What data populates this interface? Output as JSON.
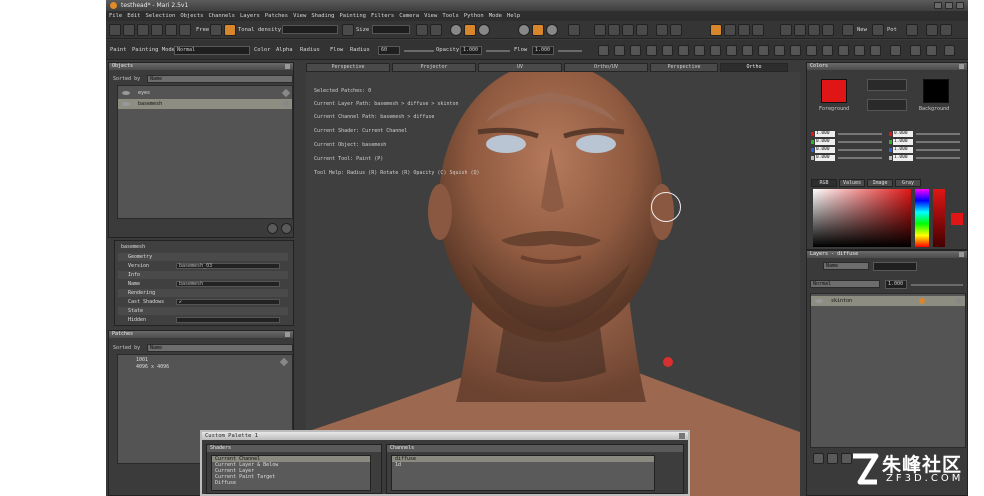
{
  "window": {
    "title": "testhead* - Mari 2.5v1"
  },
  "menu": [
    "File",
    "Edit",
    "Selection",
    "Objects",
    "Channels",
    "Layers",
    "Patches",
    "View",
    "Shading",
    "Painting",
    "Filters",
    "Camera",
    "View",
    "Tools",
    "Python",
    "Mode",
    "Help"
  ],
  "toolbar": {
    "free_label": "Free",
    "tonal_density_label": "Tonal density",
    "size_label": "Size",
    "new_label": "New",
    "pot_label": "Pot"
  },
  "paint_toolbar": {
    "paint_label": "Paint",
    "painting_mode_label": "Painting Mode",
    "painting_mode_value": "Normal",
    "color_label": "Color",
    "alpha_label": "Alpha",
    "radius_label": "Radius",
    "flow_label": "Flow",
    "radius2_label": "Radius",
    "radius_value": "60",
    "opacity_label": "Opacity",
    "opacity_value": "1.000",
    "flow2_label": "Flow",
    "flow_value": "1.000"
  },
  "objects_panel": {
    "title": "Objects",
    "sorted_by_label": "Sorted by",
    "sorted_by_value": "Name",
    "items": [
      "eyes",
      "basemesh"
    ]
  },
  "properties_panel": {
    "object_name": "basemesh",
    "rows": [
      {
        "label": "Geometry",
        "section": true,
        "value": ""
      },
      {
        "label": "Version",
        "section": false,
        "value": "basemesh_03"
      },
      {
        "label": "Info",
        "section": true,
        "value": ""
      },
      {
        "label": "Name",
        "section": false,
        "value": "basemesh"
      },
      {
        "label": "Rendering",
        "section": true,
        "value": ""
      },
      {
        "label": "Cast Shadows",
        "section": false,
        "value": "✔"
      },
      {
        "label": "State",
        "section": true,
        "value": ""
      },
      {
        "label": "Hidden",
        "section": false,
        "value": ""
      }
    ]
  },
  "patches_panel": {
    "title": "Patches",
    "sorted_by_label": "Sorted by",
    "sorted_by_value": "Name",
    "patch_id": "1001",
    "patch_size": "4096 x 4096"
  },
  "view_tabs": [
    "Perspective",
    "Projector",
    "UV",
    "Ortho/UV",
    "Perspective",
    "Ortho"
  ],
  "hud": {
    "selected_patches": "Selected Patches: 0",
    "layer_path": "Current Layer Path: basemesh > diffuse > skinton",
    "channel_path": "Current Channel Path: basemesh > diffuse",
    "shader": "Current Shader: Current Channel",
    "object": "Current Object: basemesh",
    "tool": "Current Tool: Paint (P)",
    "tool_help": "Tool Help:    Radius (R)  Rotate (R)  Opacity (C)  Squish (Q)"
  },
  "colors_panel": {
    "title": "Colors",
    "foreground_label": "Foreground",
    "background_label": "Background",
    "foreground_color": "#e01616",
    "background_color": "#000000",
    "rgb_values": [
      "1.000",
      "0.000",
      "0.000",
      "1.000",
      "0.000",
      "1.000",
      "0.000",
      "1.000"
    ],
    "tabs": [
      "RGB",
      "Values",
      "Image",
      "Gray"
    ]
  },
  "layers_panel": {
    "title": "Layers - diffuse",
    "filter_value": "Name",
    "blend_mode": "Normal",
    "opacity_value": "1.000",
    "layer_name": "skinton"
  },
  "custom_palette": {
    "title": "Custom Palette 1",
    "shaders_title": "Shaders",
    "shaders_items": [
      "Current Channel",
      "Current Layer & Below",
      "Current Layer",
      "Current Paint Target",
      "Diffuse"
    ],
    "channels_title": "Channels",
    "channels_items": [
      "diffuse",
      "1d"
    ]
  },
  "watermark": {
    "brand": "朱峰社区",
    "domain": "ZF3D.COM"
  }
}
